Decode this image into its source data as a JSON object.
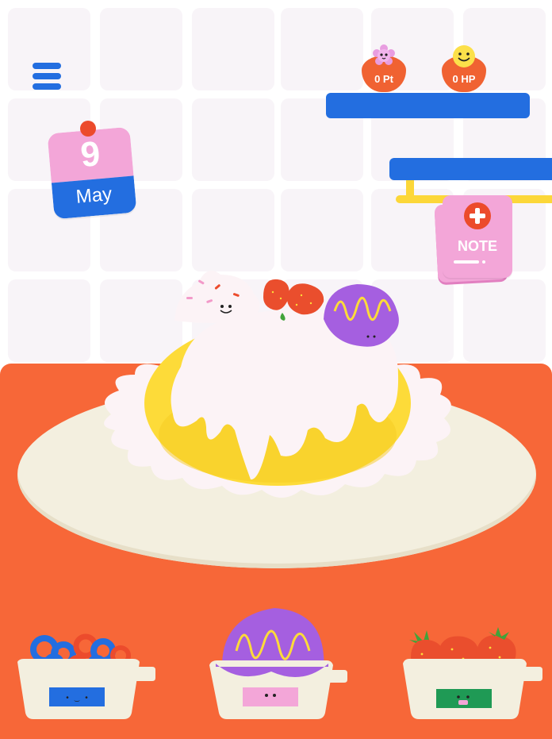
{
  "hud": {
    "points_label": "0 Pt",
    "hp_label": "0 HP"
  },
  "calendar": {
    "day": "9",
    "month": "May"
  },
  "note_button": {
    "label": "NOTE"
  },
  "icons": {
    "menu": "hamburger-menu-icon",
    "add": "plus-icon",
    "points_mascot": "flower-face-icon",
    "hp_mascot": "smiley-face-icon"
  },
  "colors": {
    "table": "#f76738",
    "plate": "#f3efdf",
    "shelf": "#236ee0",
    "accent_pink": "#f3a6d8",
    "custard": "#fddb39",
    "cream": "#fcf3f6",
    "tile": "#f8f4f8"
  },
  "toppings": [
    {
      "name": "cereal-rings"
    },
    {
      "name": "ube-ice-cream"
    },
    {
      "name": "strawberries"
    }
  ]
}
